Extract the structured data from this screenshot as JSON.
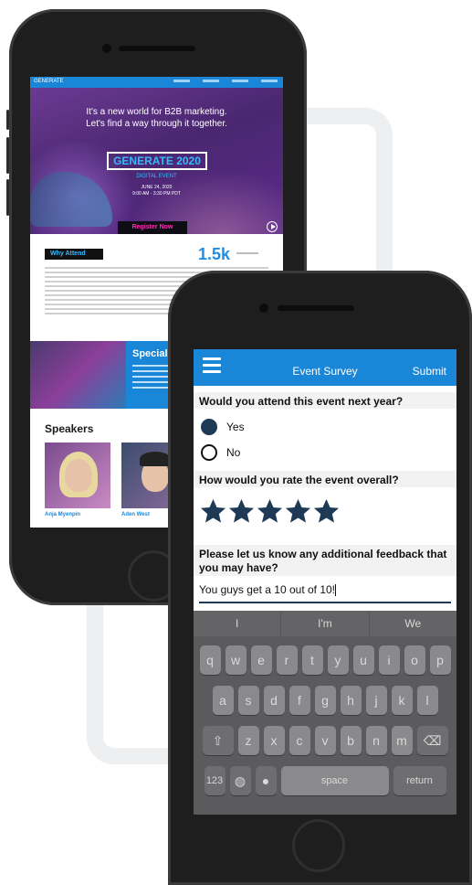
{
  "back_phone": {
    "logo": "GENERATE",
    "hero_line1": "It's a new world for B2B marketing.",
    "hero_line2": "Let's find a way through it together.",
    "event_name": "GENERATE 2020",
    "event_type": "DIGITAL EVENT",
    "event_date": "JUNE 24, 2020",
    "event_time": "9:00 AM - 3:30 PM PDT",
    "register_label": "Register Now",
    "why_attend": "Why Attend",
    "attendee_count": "1.5k",
    "spec_title": "Specializ",
    "speakers_title": "Speakers",
    "speaker1": "Anja Myenpin",
    "speaker2": "Aden West"
  },
  "app": {
    "title": "Event Survey",
    "submit_label": "Submit",
    "q1": "Would you attend this event next year?",
    "q1_options": [
      "Yes",
      "No"
    ],
    "q1_selected": "Yes",
    "q2": "How would you rate the event overall?",
    "rating": 5,
    "rating_max": 5,
    "q3_line1": "Please let us know any additional feedback that",
    "q3_line2": "you may have?",
    "feedback_value": "You guys get a 10 out of 10!"
  },
  "keyboard": {
    "suggestions": [
      "I",
      "I'm",
      "We"
    ],
    "row1": [
      "q",
      "w",
      "e",
      "r",
      "t",
      "y",
      "u",
      "i",
      "o",
      "p"
    ],
    "row2": [
      "a",
      "s",
      "d",
      "f",
      "g",
      "h",
      "j",
      "k",
      "l"
    ],
    "row3": [
      "z",
      "x",
      "c",
      "v",
      "b",
      "n",
      "m"
    ],
    "numbers_label": "123",
    "space_label": "space",
    "return_label": "return"
  },
  "colors": {
    "brand_blue": "#1a86d8",
    "selected_dark": "#1f3a57"
  }
}
